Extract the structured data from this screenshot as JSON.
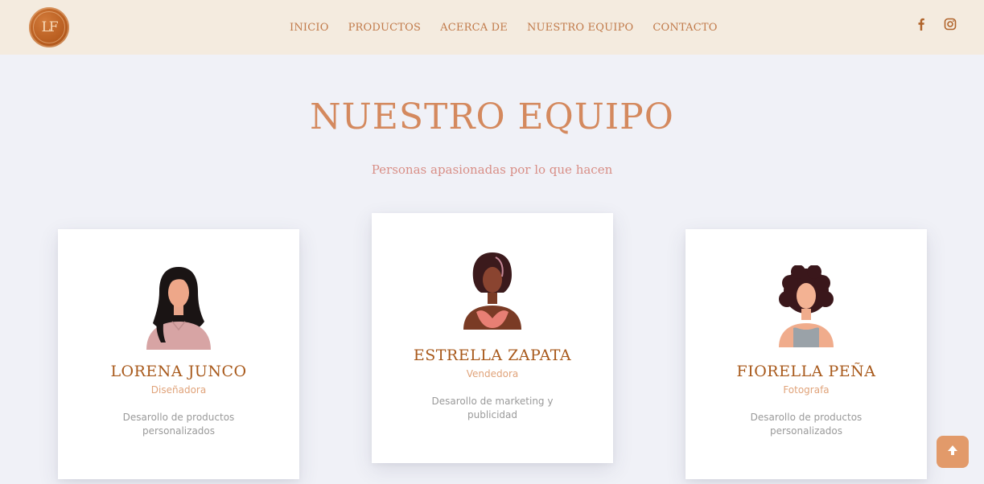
{
  "header": {
    "logo_text": "LF",
    "nav": [
      "INICIO",
      "PRODUCTOS",
      "ACERCA DE",
      "NUESTRO EQUIPO",
      "CONTACTO"
    ],
    "social": [
      "facebook-icon",
      "instagram-icon"
    ]
  },
  "team": {
    "title": "NUESTRO EQUIPO",
    "subtitle": "Personas apasionadas por lo que hacen",
    "members": [
      {
        "name": "LORENA JUNCO",
        "role": "Diseñadora",
        "description": "Desarollo de productos personalizados"
      },
      {
        "name": "ESTRELLA ZAPATA",
        "role": "Vendedora",
        "description": "Desarollo de marketing y publicidad"
      },
      {
        "name": "FIORELLA PEÑA",
        "role": "Fotografa",
        "description": "Desarollo de productos personalizados"
      }
    ]
  },
  "colors": {
    "header_bg": "#f4ebdf",
    "page_bg": "#f0f1f7",
    "accent": "#d4895e",
    "name": "#a8591b",
    "scroll_button": "#e29a6a"
  },
  "scroll_top_icon": "arrow-up-icon"
}
